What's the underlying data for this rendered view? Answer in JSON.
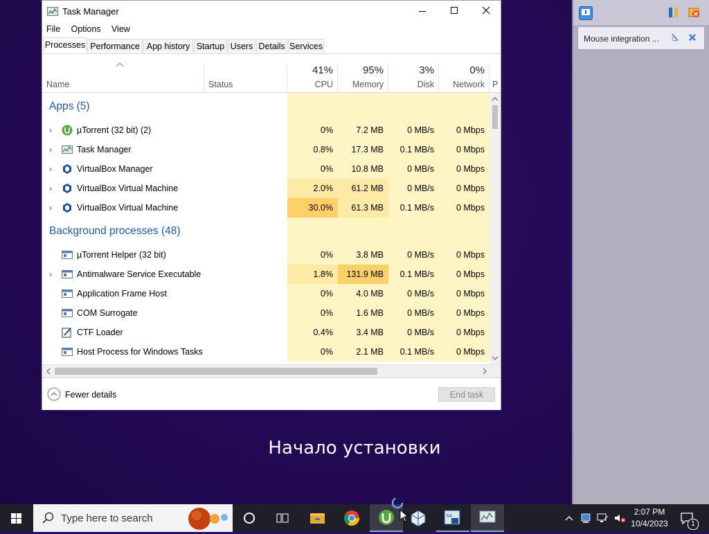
{
  "desktop": {
    "setup_text": "Начало установки"
  },
  "vbox": {
    "notice_text": "Mouse integration ..."
  },
  "window": {
    "title": "Task Manager",
    "menu": [
      "File",
      "Options",
      "View"
    ],
    "tabs": [
      "Processes",
      "Performance",
      "App history",
      "Startup",
      "Users",
      "Details",
      "Services"
    ],
    "active_tab": "Processes",
    "columns": {
      "name": "Name",
      "status": "Status",
      "cpu": {
        "pct": "41%",
        "label": "CPU"
      },
      "memory": {
        "pct": "95%",
        "label": "Memory"
      },
      "disk": {
        "pct": "3%",
        "label": "Disk"
      },
      "network": {
        "pct": "0%",
        "label": "Network"
      },
      "power": "P"
    },
    "groups": [
      {
        "title": "Apps (5)"
      },
      {
        "title": "Background processes (48)"
      }
    ],
    "apps": [
      {
        "name": "µTorrent (32 bit) (2)",
        "cpu": "0%",
        "memory": "7.2 MB",
        "disk": "0 MB/s",
        "network": "0 Mbps",
        "icon": "utorrent-icon",
        "expandable": "›"
      },
      {
        "name": "Task Manager",
        "cpu": "0.8%",
        "memory": "17.3 MB",
        "disk": "0.1 MB/s",
        "network": "0 Mbps",
        "icon": "task-manager-icon",
        "expandable": "›"
      },
      {
        "name": "VirtualBox Manager",
        "cpu": "0%",
        "memory": "10.8 MB",
        "disk": "0 MB/s",
        "network": "0 Mbps",
        "icon": "virtualbox-icon",
        "expandable": "›"
      },
      {
        "name": "VirtualBox Virtual Machine",
        "cpu": "2.0%",
        "memory": "61.2 MB",
        "disk": "0 MB/s",
        "network": "0 Mbps",
        "icon": "virtualbox-icon",
        "expandable": "›"
      },
      {
        "name": "VirtualBox Virtual Machine",
        "cpu": "30.0%",
        "memory": "61.3 MB",
        "disk": "0.1 MB/s",
        "network": "0 Mbps",
        "icon": "virtualbox-icon",
        "expandable": "›"
      }
    ],
    "background": [
      {
        "name": "µTorrent Helper (32 bit)",
        "cpu": "0%",
        "memory": "3.8 MB",
        "disk": "0 MB/s",
        "network": "0 Mbps",
        "icon": "process-icon",
        "expandable": ""
      },
      {
        "name": "Antimalware Service Executable",
        "cpu": "1.8%",
        "memory": "131.9 MB",
        "disk": "0.1 MB/s",
        "network": "0 Mbps",
        "icon": "process-icon",
        "expandable": "›"
      },
      {
        "name": "Application Frame Host",
        "cpu": "0%",
        "memory": "4.0 MB",
        "disk": "0 MB/s",
        "network": "0 Mbps",
        "icon": "process-icon",
        "expandable": ""
      },
      {
        "name": "COM Surrogate",
        "cpu": "0%",
        "memory": "1.6 MB",
        "disk": "0 MB/s",
        "network": "0 Mbps",
        "icon": "process-icon",
        "expandable": ""
      },
      {
        "name": "CTF Loader",
        "cpu": "0.4%",
        "memory": "3.4 MB",
        "disk": "0 MB/s",
        "network": "0 Mbps",
        "icon": "ctf-loader-icon",
        "expandable": ""
      },
      {
        "name": "Host Process for Windows Tasks",
        "cpu": "0%",
        "memory": "2.1 MB",
        "disk": "0.1 MB/s",
        "network": "0 Mbps",
        "icon": "process-icon",
        "expandable": ""
      }
    ],
    "fewer_details": "Fewer details",
    "end_task": "End task"
  },
  "taskbar": {
    "search_placeholder": "Type here to search",
    "time": "2:07 PM",
    "date": "10/4/2023",
    "notification_count": "1",
    "apps": [
      "start-icon",
      "cortana-icon",
      "task-view-icon",
      "file-explorer-icon",
      "chrome-icon",
      "utorrent-icon",
      "virtualbox-icon",
      "vbox-vm-icon",
      "task-manager-icon"
    ]
  },
  "colors": {
    "heat_low": "#fff4c4",
    "heat_mid": "#ffe9a6",
    "heat_high": "#ffd06a",
    "group_title": "#1e5aa8",
    "desktop": "#24095a",
    "taskbar": "#1f1f2a"
  }
}
